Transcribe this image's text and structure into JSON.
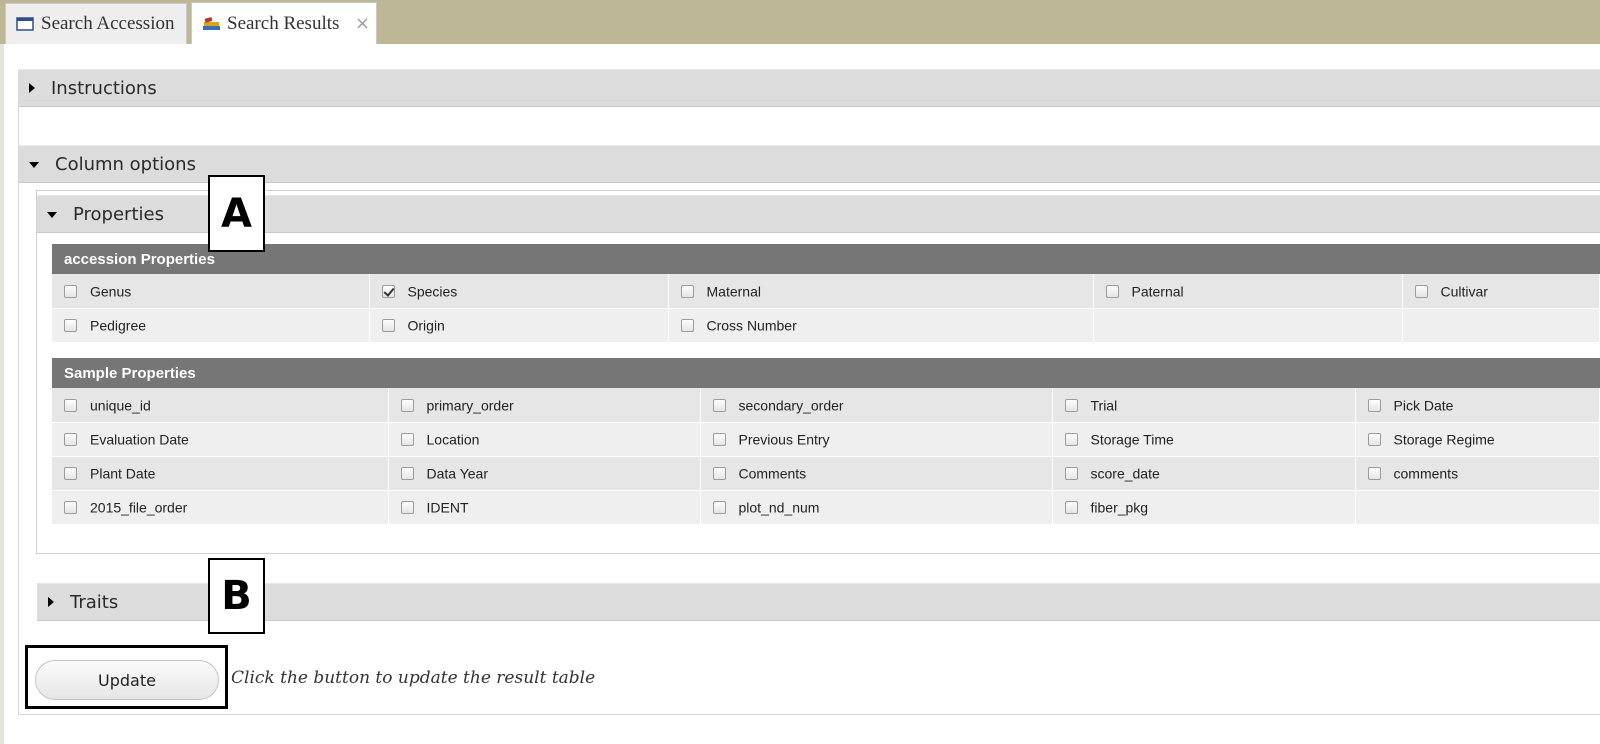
{
  "tabs": [
    {
      "label": "Search Accession",
      "icon": "window-icon"
    },
    {
      "label": "Search Results",
      "icon": "books-icon",
      "close": "×"
    }
  ],
  "sections": {
    "instructions": "Instructions",
    "column_options": "Column options",
    "properties": "Properties",
    "traits": "Traits"
  },
  "accession_properties": {
    "header": "accession Properties",
    "rows": [
      [
        {
          "label": "Genus",
          "checked": false
        },
        {
          "label": "Species",
          "checked": true
        },
        {
          "label": "Maternal",
          "checked": false
        },
        {
          "label": "Paternal",
          "checked": false
        },
        {
          "label": "Cultivar",
          "checked": false
        }
      ],
      [
        {
          "label": "Pedigree",
          "checked": false
        },
        {
          "label": "Origin",
          "checked": false
        },
        {
          "label": "Cross Number",
          "checked": false
        },
        null,
        null
      ]
    ]
  },
  "sample_properties": {
    "header": "Sample Properties",
    "rows": [
      [
        {
          "label": "unique_id",
          "checked": false
        },
        {
          "label": "primary_order",
          "checked": false
        },
        {
          "label": "secondary_order",
          "checked": false
        },
        {
          "label": "Trial",
          "checked": false
        },
        {
          "label": "Pick Date",
          "checked": false
        }
      ],
      [
        {
          "label": "Evaluation Date",
          "checked": false
        },
        {
          "label": "Location",
          "checked": false
        },
        {
          "label": "Previous Entry",
          "checked": false
        },
        {
          "label": "Storage Time",
          "checked": false
        },
        {
          "label": "Storage Regime",
          "checked": false
        }
      ],
      [
        {
          "label": "Plant Date",
          "checked": false
        },
        {
          "label": "Data Year",
          "checked": false
        },
        {
          "label": "Comments",
          "checked": false
        },
        {
          "label": "score_date",
          "checked": false
        },
        {
          "label": "comments",
          "checked": false
        }
      ],
      [
        {
          "label": "2015_file_order",
          "checked": false
        },
        {
          "label": "IDENT",
          "checked": false
        },
        {
          "label": "plot_nd_num",
          "checked": false
        },
        {
          "label": "fiber_pkg",
          "checked": false
        },
        null
      ]
    ]
  },
  "annotations": {
    "a": "A",
    "b": "B"
  },
  "update": {
    "label": "Update",
    "hint": "Click the button to update the result table"
  }
}
